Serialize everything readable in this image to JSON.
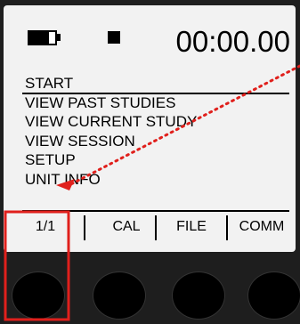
{
  "status": {
    "clock": "00:00.00",
    "battery_icon": "battery-icon",
    "indicator_icon": "status-square-icon"
  },
  "menu": {
    "items": [
      {
        "label": "START"
      },
      {
        "label": "VIEW PAST STUDIES"
      },
      {
        "label": "VIEW CURRENT STUDY"
      },
      {
        "label": "VIEW SESSION"
      },
      {
        "label": "SETUP"
      },
      {
        "label": "UNIT INFO"
      }
    ]
  },
  "softkeys": [
    {
      "label": "1/1"
    },
    {
      "label": "CAL"
    },
    {
      "label": "FILE"
    },
    {
      "label": "COMM"
    }
  ],
  "annotation": {
    "highlight_color": "#e0201c"
  }
}
